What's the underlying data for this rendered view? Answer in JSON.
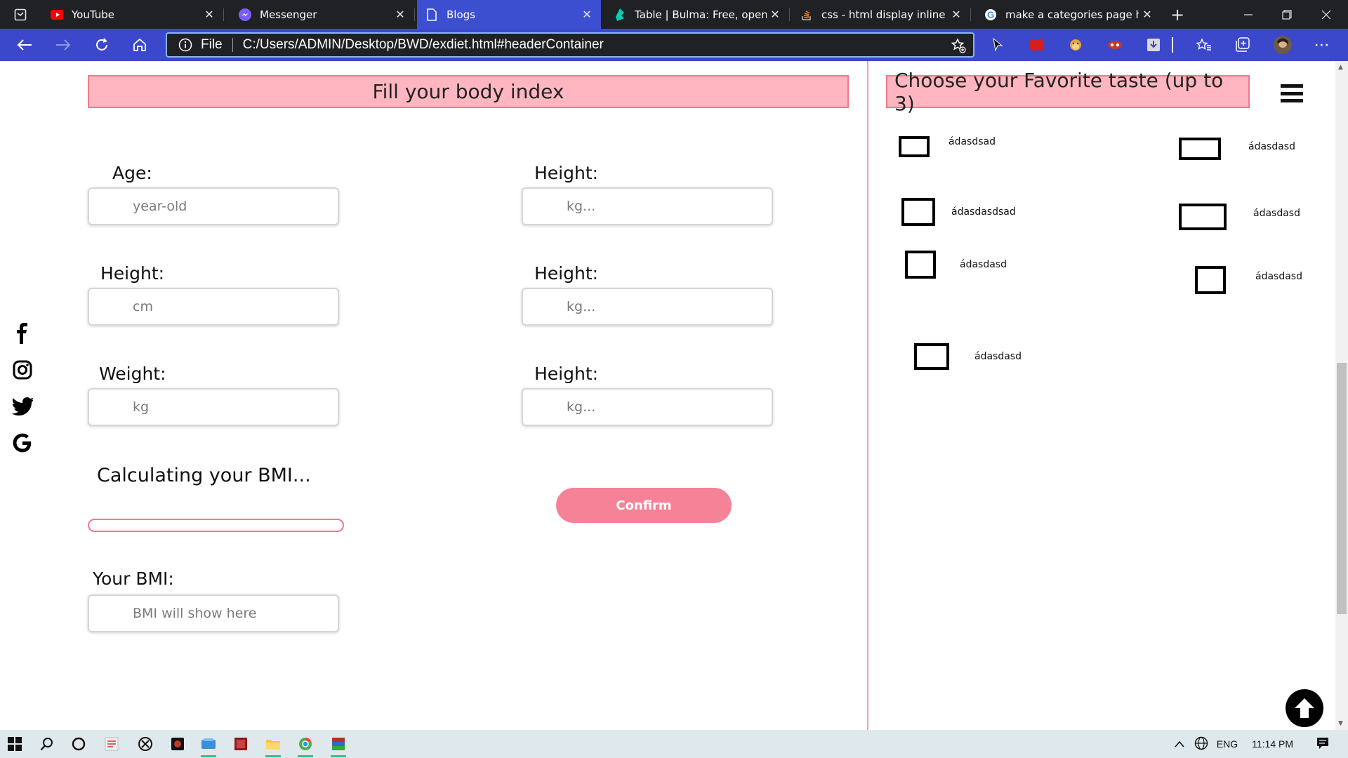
{
  "browser": {
    "tabs": [
      {
        "title": "YouTube",
        "icon": "youtube-icon"
      },
      {
        "title": "Messenger",
        "icon": "messenger-icon"
      },
      {
        "title": "Blogs",
        "icon": "page-icon"
      },
      {
        "title": "Table | Bulma: Free, open so",
        "icon": "bulma-icon"
      },
      {
        "title": "css - html display inline pro",
        "icon": "stackoverflow-icon"
      },
      {
        "title": "make a categories page htm",
        "icon": "google-icon"
      }
    ],
    "active_tab_index": 2,
    "address": {
      "scheme": "File",
      "url": "C:/Users/ADMIN/Desktop/BWD/exdiet.html#headerContainer"
    }
  },
  "body_index": {
    "title": "Fill your body index",
    "fields": [
      {
        "label": "Age:",
        "placeholder": "year-old"
      },
      {
        "label": "Height:",
        "placeholder": "cm"
      },
      {
        "label": "Weight:",
        "placeholder": "kg"
      }
    ],
    "right_fields": [
      {
        "label": "Height:",
        "placeholder": "kg..."
      },
      {
        "label": "Height:",
        "placeholder": "kg..."
      },
      {
        "label": "Height:",
        "placeholder": "kg..."
      }
    ],
    "calculating_label": "Calculating your BMI...",
    "progress": 0,
    "confirm_label": "Confirm",
    "bmi_label": "Your BMI:",
    "bmi_placeholder": "BMI will show here"
  },
  "taste": {
    "title": "Choose your Favorite taste (up to 3)",
    "items": [
      {
        "label": "ádasdsad"
      },
      {
        "label": "ádasdasdsad"
      },
      {
        "label": "ádasdasd"
      },
      {
        "label": "ádasdasd"
      },
      {
        "label": "ádasdasd"
      },
      {
        "label": "ádasdasd"
      },
      {
        "label": "ádasdasd"
      }
    ]
  },
  "social": [
    "facebook-icon",
    "instagram-icon",
    "twitter-icon",
    "google-icon"
  ],
  "colors": {
    "accent_pink": "#f58297",
    "banner_pink": "#ffb6c1",
    "tab_active": "#3c4fd0",
    "toolbar": "#3b48cc"
  },
  "taskbar": {
    "language": "ENG",
    "time": "11:14 PM"
  }
}
